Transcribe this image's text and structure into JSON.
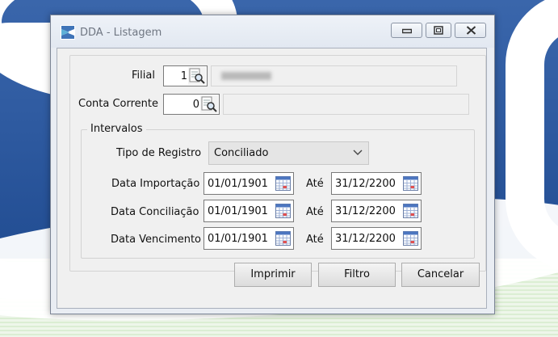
{
  "window": {
    "title": "DDA - Listagem",
    "controls": [
      "minimize-icon",
      "maximize-icon",
      "close-icon"
    ]
  },
  "form": {
    "filial": {
      "label": "Filial",
      "code": "1",
      "name_blurred": ""
    },
    "conta_corrente": {
      "label": "Conta Corrente",
      "code": "0",
      "name": ""
    },
    "intervalos": {
      "title": "Intervalos",
      "tipo_registro": {
        "label": "Tipo de Registro",
        "selected": "Conciliado"
      },
      "rows": [
        {
          "label": "Data Importação",
          "from": "01/01/1901",
          "ate_label": "Até",
          "to": "31/12/2200"
        },
        {
          "label": "Data Conciliação",
          "from": "01/01/1901",
          "ate_label": "Até",
          "to": "31/12/2200"
        },
        {
          "label": "Data Vencimento",
          "from": "01/01/1901",
          "ate_label": "Até",
          "to": "31/12/2200"
        }
      ]
    }
  },
  "buttons": {
    "imprimir": "Imprimir",
    "filtro": "Filtro",
    "cancelar": "Cancelar"
  },
  "colors": {
    "desktop_blue": "#2e5aa0",
    "window_bg": "#e9edf3",
    "panel_bg": "#f0f0f0",
    "title_text": "#6f7682"
  }
}
